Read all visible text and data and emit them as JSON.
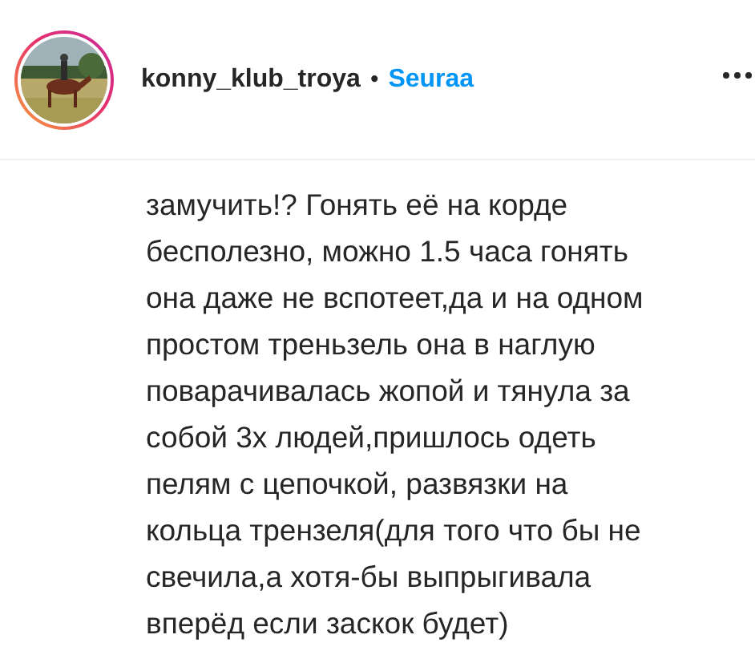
{
  "post_header": {
    "avatar": {
      "story_ring": true
    },
    "username": "konny_klub_troya",
    "separator": "•",
    "follow_button": "Seuraa"
  },
  "caption": {
    "lines": [
      "замучить!? Гонять её на корде",
      "бесполезно, можно 1.5 часа гонять",
      "она даже не вспотеет,да и на одном",
      "простом треньзель она в наглую",
      "поварачивалась жопой и тянула за",
      "собой 3х людей,пришлось одеть",
      "пелям с цепочкой, развязки на",
      "кольца трензеля(для того что бы не",
      "свечила,а хотя-бы выпрыгивала",
      "вперёд если заскок будет)"
    ]
  }
}
